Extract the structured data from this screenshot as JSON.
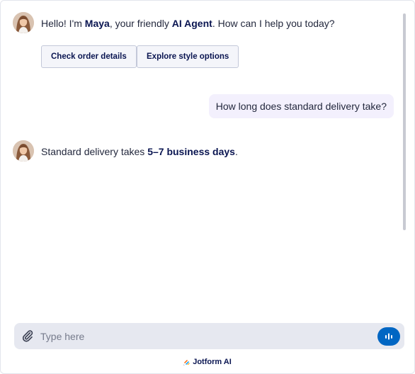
{
  "agent": {
    "name": "Maya",
    "greeting": {
      "prefix": "Hello! I'm ",
      "name": "Maya",
      "middle": ", your friendly ",
      "role": "AI Agent",
      "suffix": ". How can I help you today?"
    },
    "quick_replies": [
      {
        "label": "Check order details"
      },
      {
        "label": "Explore style options"
      }
    ],
    "reply": {
      "prefix": "Standard delivery takes ",
      "highlight": "5–7 business days",
      "suffix": "."
    }
  },
  "user": {
    "message": "How long does standard delivery take?"
  },
  "composer": {
    "placeholder": "Type here",
    "value": ""
  },
  "footer": {
    "brand": "Jotform AI"
  },
  "colors": {
    "accent": "#0066c3",
    "text_dark": "#0a1551",
    "user_bubble": "#f3f0fd",
    "composer_bg": "#e6e8f0"
  },
  "icons": {
    "attach": "paperclip-icon",
    "voice": "waveform-icon",
    "brand": "jotform-logo-icon"
  }
}
